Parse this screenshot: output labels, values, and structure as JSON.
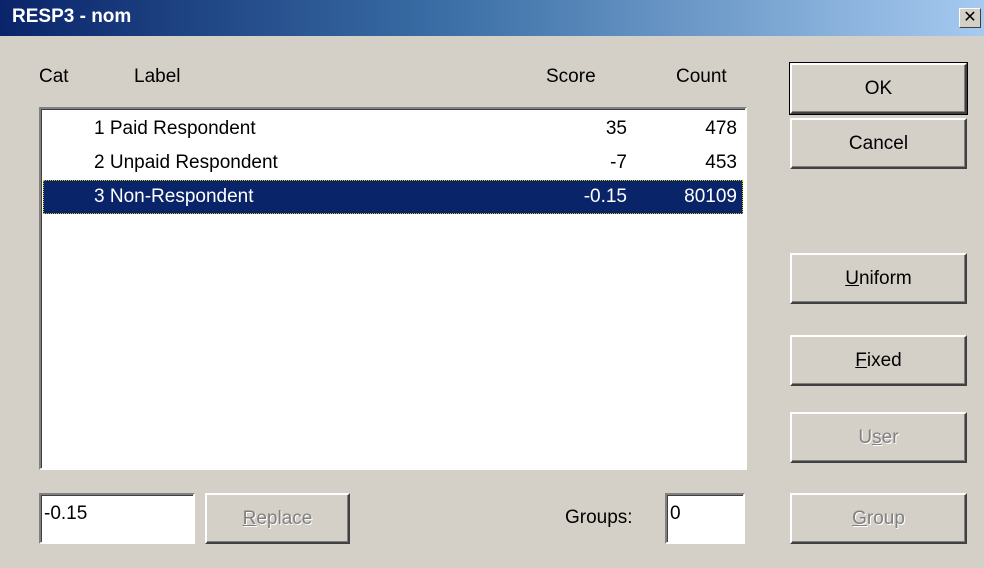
{
  "window": {
    "title": "RESP3 - nom",
    "close_glyph": "✕"
  },
  "columns": {
    "cat": "Cat",
    "label": "Label",
    "score": "Score",
    "count": "Count"
  },
  "rows": [
    {
      "label": "1 Paid Respondent",
      "score": "35",
      "count": "478",
      "selected": false
    },
    {
      "label": "2 Unpaid Respondent",
      "score": "-7",
      "count": "453",
      "selected": false
    },
    {
      "label": "3 Non-Respondent",
      "score": "-0.15",
      "count": "80109",
      "selected": true
    }
  ],
  "buttons": {
    "ok": "OK",
    "cancel": "Cancel",
    "uniform": {
      "mnemonic": "U",
      "rest": "niform"
    },
    "fixed": {
      "mnemonic": "F",
      "rest": "ixed"
    },
    "user": {
      "pre": "U",
      "mnemonic": "s",
      "rest": "er"
    },
    "group": {
      "mnemonic": "G",
      "rest": "roup"
    },
    "replace": {
      "mnemonic": "R",
      "rest": "eplace"
    }
  },
  "score_input": {
    "value": "-0.15"
  },
  "groups": {
    "label": "Groups:",
    "value": "0"
  },
  "colors": {
    "selection": "#0a246a",
    "face": "#d4d0c8"
  }
}
